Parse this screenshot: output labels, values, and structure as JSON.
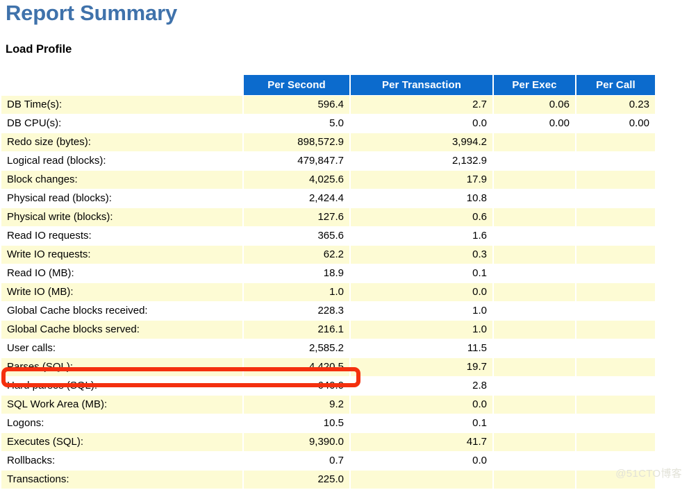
{
  "document": {
    "title": "Report Summary",
    "section_title": "Load Profile",
    "watermark": "@51CTO博客"
  },
  "colors": {
    "title_blue": "#3f72ab",
    "header_blue": "#0c6bcd",
    "row_yellow": "#fdfbd4",
    "row_white": "#ffffff",
    "highlight_red": "#f4300e"
  },
  "table": {
    "columns": [
      "",
      "Per Second",
      "Per Transaction",
      "Per Exec",
      "Per Call"
    ],
    "rows": [
      {
        "label": "DB Time(s):",
        "per_second": "596.4",
        "per_transaction": "2.7",
        "per_exec": "0.06",
        "per_call": "0.23"
      },
      {
        "label": "DB CPU(s):",
        "per_second": "5.0",
        "per_transaction": "0.0",
        "per_exec": "0.00",
        "per_call": "0.00"
      },
      {
        "label": "Redo size (bytes):",
        "per_second": "898,572.9",
        "per_transaction": "3,994.2",
        "per_exec": "",
        "per_call": ""
      },
      {
        "label": "Logical read (blocks):",
        "per_second": "479,847.7",
        "per_transaction": "2,132.9",
        "per_exec": "",
        "per_call": ""
      },
      {
        "label": "Block changes:",
        "per_second": "4,025.6",
        "per_transaction": "17.9",
        "per_exec": "",
        "per_call": ""
      },
      {
        "label": "Physical read (blocks):",
        "per_second": "2,424.4",
        "per_transaction": "10.8",
        "per_exec": "",
        "per_call": ""
      },
      {
        "label": "Physical write (blocks):",
        "per_second": "127.6",
        "per_transaction": "0.6",
        "per_exec": "",
        "per_call": ""
      },
      {
        "label": "Read IO requests:",
        "per_second": "365.6",
        "per_transaction": "1.6",
        "per_exec": "",
        "per_call": ""
      },
      {
        "label": "Write IO requests:",
        "per_second": "62.2",
        "per_transaction": "0.3",
        "per_exec": "",
        "per_call": ""
      },
      {
        "label": "Read IO (MB):",
        "per_second": "18.9",
        "per_transaction": "0.1",
        "per_exec": "",
        "per_call": ""
      },
      {
        "label": "Write IO (MB):",
        "per_second": "1.0",
        "per_transaction": "0.0",
        "per_exec": "",
        "per_call": ""
      },
      {
        "label": "Global Cache blocks received:",
        "per_second": "228.3",
        "per_transaction": "1.0",
        "per_exec": "",
        "per_call": ""
      },
      {
        "label": "Global Cache blocks served:",
        "per_second": "216.1",
        "per_transaction": "1.0",
        "per_exec": "",
        "per_call": ""
      },
      {
        "label": "User calls:",
        "per_second": "2,585.2",
        "per_transaction": "11.5",
        "per_exec": "",
        "per_call": ""
      },
      {
        "label": "Parses (SQL):",
        "per_second": "4,420.5",
        "per_transaction": "19.7",
        "per_exec": "",
        "per_call": ""
      },
      {
        "label": "Hard parses (SQL):",
        "per_second": "640.0",
        "per_transaction": "2.8",
        "per_exec": "",
        "per_call": ""
      },
      {
        "label": "SQL Work Area (MB):",
        "per_second": "9.2",
        "per_transaction": "0.0",
        "per_exec": "",
        "per_call": ""
      },
      {
        "label": "Logons:",
        "per_second": "10.5",
        "per_transaction": "0.1",
        "per_exec": "",
        "per_call": ""
      },
      {
        "label": "Executes (SQL):",
        "per_second": "9,390.0",
        "per_transaction": "41.7",
        "per_exec": "",
        "per_call": ""
      },
      {
        "label": "Rollbacks:",
        "per_second": "0.7",
        "per_transaction": "0.0",
        "per_exec": "",
        "per_call": ""
      },
      {
        "label": "Transactions:",
        "per_second": "225.0",
        "per_transaction": "",
        "per_exec": "",
        "per_call": ""
      }
    ]
  },
  "annotation": {
    "highlighted_row_label": "Hard parses (SQL):",
    "highlighted_row_value": "640.0"
  }
}
